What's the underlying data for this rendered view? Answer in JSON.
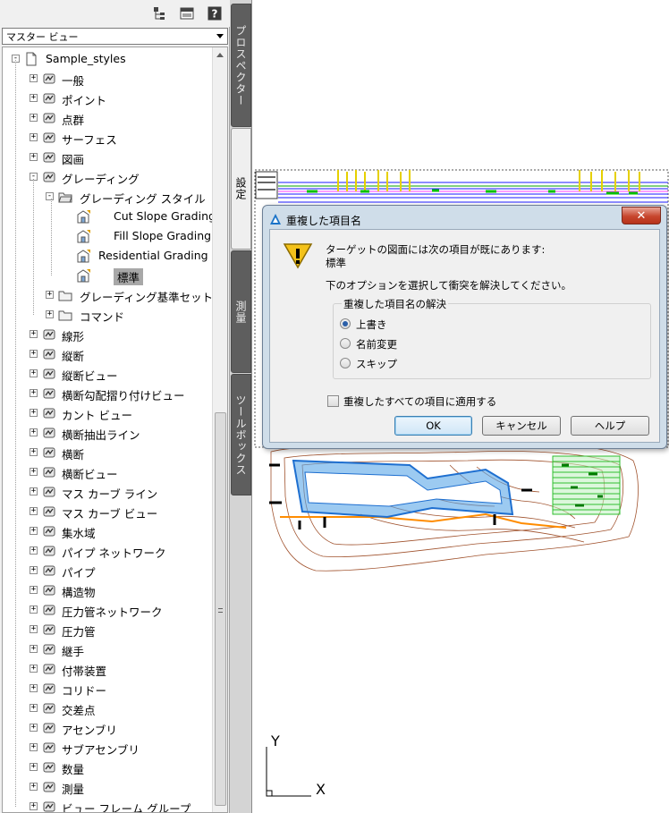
{
  "panel": {
    "view_select": "マスター ビュー",
    "root": "Sample_styles",
    "tree": [
      {
        "label": "一般",
        "icon": "general-icon",
        "level": 1,
        "expander": "+"
      },
      {
        "label": "ポイント",
        "icon": "point-icon",
        "level": 1,
        "expander": "+"
      },
      {
        "label": "点群",
        "icon": "point-group-icon",
        "level": 1,
        "expander": "+"
      },
      {
        "label": "サーフェス",
        "icon": "surface-icon",
        "level": 1,
        "expander": "+"
      },
      {
        "label": "図画",
        "icon": "parcel-icon",
        "level": 1,
        "expander": "+"
      },
      {
        "label": "グレーディング",
        "icon": "grading-icon",
        "level": 1,
        "expander": "-"
      },
      {
        "label": "グレーディング スタイル",
        "icon": "folder-open-icon",
        "level": 2,
        "expander": "-"
      },
      {
        "label": "Cut Slope Grading",
        "icon": "style-icon",
        "level": 3,
        "expander": ""
      },
      {
        "label": "Fill Slope Grading",
        "icon": "style-icon",
        "level": 3,
        "expander": ""
      },
      {
        "label": "Residential Grading",
        "icon": "style-icon",
        "level": 3,
        "expander": ""
      },
      {
        "label": "標準",
        "icon": "style-icon",
        "level": 3,
        "expander": "",
        "selected": true
      },
      {
        "label": "グレーディング基準セット",
        "icon": "folder-icon",
        "level": 2,
        "expander": "+"
      },
      {
        "label": "コマンド",
        "icon": "folder-icon",
        "level": 2,
        "expander": "+"
      },
      {
        "label": "線形",
        "icon": "alignment-icon",
        "level": 1,
        "expander": "+"
      },
      {
        "label": "縦断",
        "icon": "profile-icon",
        "level": 1,
        "expander": "+"
      },
      {
        "label": "縦断ビュー",
        "icon": "profile-view-icon",
        "level": 1,
        "expander": "+"
      },
      {
        "label": "横断勾配摺り付けビュー",
        "icon": "superelevation-icon",
        "level": 1,
        "expander": "+"
      },
      {
        "label": "カント ビュー",
        "icon": "cant-view-icon",
        "level": 1,
        "expander": "+"
      },
      {
        "label": "横断抽出ライン",
        "icon": "sample-line-icon",
        "level": 1,
        "expander": "+"
      },
      {
        "label": "横断",
        "icon": "section-icon",
        "level": 1,
        "expander": "+"
      },
      {
        "label": "横断ビュー",
        "icon": "section-view-icon",
        "level": 1,
        "expander": "+"
      },
      {
        "label": "マス カーブ ライン",
        "icon": "mass-haul-line-icon",
        "level": 1,
        "expander": "+"
      },
      {
        "label": "マス カーブ ビュー",
        "icon": "mass-haul-view-icon",
        "level": 1,
        "expander": "+"
      },
      {
        "label": "集水域",
        "icon": "catchment-icon",
        "level": 1,
        "expander": "+"
      },
      {
        "label": "パイプ ネットワーク",
        "icon": "pipe-network-icon",
        "level": 1,
        "expander": "+"
      },
      {
        "label": "パイプ",
        "icon": "pipe-icon",
        "level": 1,
        "expander": "+"
      },
      {
        "label": "構造物",
        "icon": "structure-icon",
        "level": 1,
        "expander": "+"
      },
      {
        "label": "圧力管ネットワーク",
        "icon": "pressure-network-icon",
        "level": 1,
        "expander": "+"
      },
      {
        "label": "圧力管",
        "icon": "pressure-pipe-icon",
        "level": 1,
        "expander": "+"
      },
      {
        "label": "継手",
        "icon": "fitting-icon",
        "level": 1,
        "expander": "+"
      },
      {
        "label": "付帯装置",
        "icon": "appurtenance-icon",
        "level": 1,
        "expander": "+"
      },
      {
        "label": "コリドー",
        "icon": "corridor-icon",
        "level": 1,
        "expander": "+"
      },
      {
        "label": "交差点",
        "icon": "intersection-icon",
        "level": 1,
        "expander": "+"
      },
      {
        "label": "アセンブリ",
        "icon": "assembly-icon",
        "level": 1,
        "expander": "+"
      },
      {
        "label": "サブアセンブリ",
        "icon": "subassembly-icon",
        "level": 1,
        "expander": "+"
      },
      {
        "label": "数量",
        "icon": "quantity-icon",
        "level": 1,
        "expander": "+"
      },
      {
        "label": "測量",
        "icon": "survey-icon",
        "level": 1,
        "expander": "+"
      },
      {
        "label": "ビュー フレーム グループ",
        "icon": "view-frame-icon",
        "level": 1,
        "expander": "+"
      }
    ]
  },
  "tabs": [
    {
      "label": "プロスペクター",
      "active": false
    },
    {
      "label": "設定",
      "active": true
    },
    {
      "label": "測量",
      "active": false
    },
    {
      "label": "ツールボックス",
      "active": false
    }
  ],
  "drawing": {
    "ucs_y": "Y",
    "ucs_x": "X"
  },
  "dialog": {
    "title": "重複した項目名",
    "message_line1": "ターゲットの図面には次の項目が既にあります:",
    "message_line2": "標準",
    "instruction": "下のオプションを選択して衝突を解決してください。",
    "group_label": "重複した項目名の解決",
    "options": [
      {
        "label": "上書き",
        "selected": true
      },
      {
        "label": "名前変更",
        "selected": false
      },
      {
        "label": "スキップ",
        "selected": false
      }
    ],
    "apply_all_label": "重複したすべての項目に適用する",
    "apply_all_checked": false,
    "ok_label": "OK",
    "cancel_label": "キャンセル",
    "help_label": "ヘルプ"
  },
  "colors": {
    "dialog_frame": "#cfdde9",
    "selection": "#a8a8a8",
    "tab_inactive": "#5e5e5e",
    "site_contour": "#a0522d",
    "site_hatch": "#1e90ff",
    "site_green": "#2fbf2f"
  }
}
